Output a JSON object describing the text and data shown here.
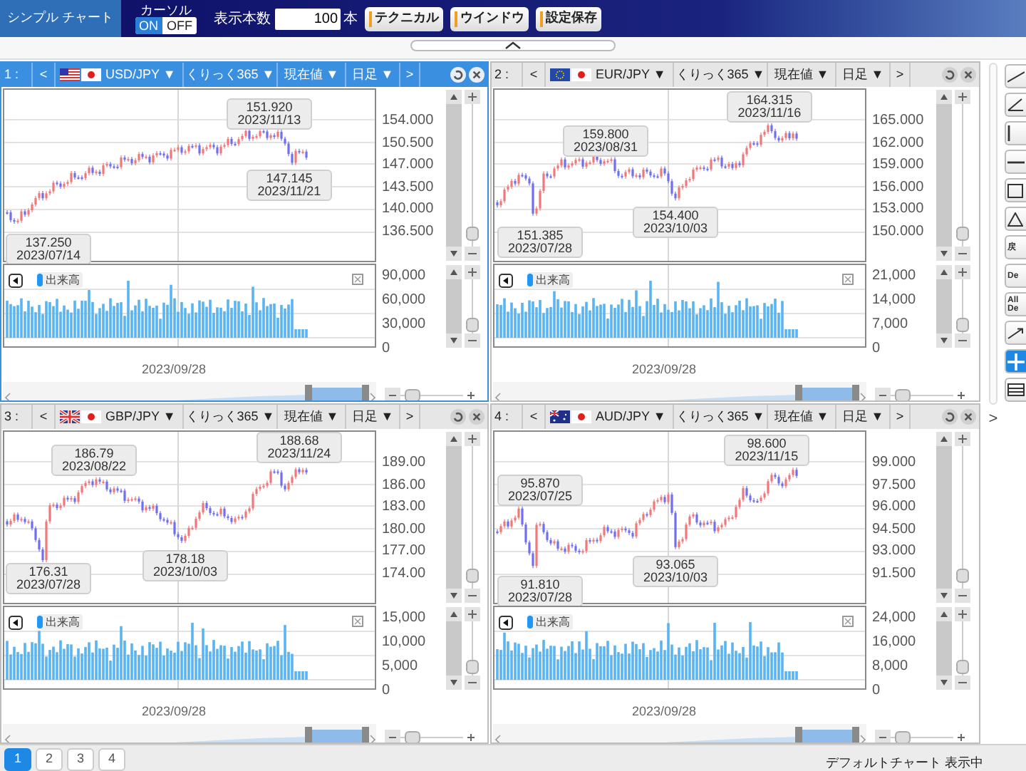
{
  "toolbar": {
    "title": "シンプル チャート",
    "cursor_label": "カーソル",
    "cursor_toggle": [
      {
        "label": "ON",
        "selected": true
      },
      {
        "label": "OFF",
        "selected": false
      }
    ],
    "count_label": "表示本数",
    "count_value": "100",
    "count_unit": "本",
    "buttons": [
      "テクニカル",
      "ウインドウ",
      "設定保存"
    ]
  },
  "panels": [
    {
      "index": "1 :",
      "active": true,
      "prev": "<",
      "pair": "USD/JPY ▼",
      "market": "くりっく365 ▼",
      "price": "現在値 ▼",
      "period": "日足 ▼",
      "next": ">",
      "y_ticks": [
        "154.000",
        "150.500",
        "147.000",
        "143.500",
        "140.000",
        "136.500"
      ],
      "annotations": [
        {
          "value": "151.920",
          "date": "2023/11/13"
        },
        {
          "value": "147.145",
          "date": "2023/11/21"
        },
        {
          "value": "137.250",
          "date": "2023/07/14"
        }
      ],
      "volume_label": "出来高",
      "volume_ticks": [
        "90,000",
        "60,000",
        "30,000",
        "0"
      ],
      "date_label": "2023/09/28",
      "price_zoom": {
        "level": 0.05
      },
      "volume_zoom": {
        "level": 0.05
      },
      "time_zoom": {
        "level": 0.1
      }
    },
    {
      "index": "2 :",
      "active": false,
      "prev": "<",
      "pair": "EUR/JPY ▼",
      "market": "くりっく365 ▼",
      "price": "現在値 ▼",
      "period": "日足 ▼",
      "next": ">",
      "y_ticks": [
        "165.000",
        "162.000",
        "159.000",
        "156.000",
        "153.000",
        "150.000"
      ],
      "annotations": [
        {
          "value": "164.315",
          "date": "2023/11/16"
        },
        {
          "value": "159.800",
          "date": "2023/08/31"
        },
        {
          "value": "154.400",
          "date": "2023/10/03"
        },
        {
          "value": "151.385",
          "date": "2023/07/28"
        }
      ],
      "volume_label": "出来高",
      "volume_ticks": [
        "21,000",
        "14,000",
        "7,000",
        "0"
      ],
      "date_label": "2023/09/28",
      "price_zoom": {
        "level": 0.05
      },
      "volume_zoom": {
        "level": 0.05
      },
      "time_zoom": {
        "level": 0.1
      }
    },
    {
      "index": "3 :",
      "active": false,
      "prev": "<",
      "pair": "GBP/JPY ▼",
      "market": "くりっく365 ▼",
      "price": "現在値 ▼",
      "period": "日足 ▼",
      "next": ">",
      "y_ticks": [
        "189.00",
        "186.00",
        "183.00",
        "180.00",
        "177.00",
        "174.00"
      ],
      "annotations": [
        {
          "value": "188.68",
          "date": "2023/11/24"
        },
        {
          "value": "186.79",
          "date": "2023/08/22"
        },
        {
          "value": "176.31",
          "date": "2023/07/28"
        },
        {
          "value": "178.18",
          "date": "2023/10/03"
        }
      ],
      "volume_label": "出来高",
      "volume_ticks": [
        "15,000",
        "10,000",
        "5,000",
        "0"
      ],
      "date_label": "2023/09/28",
      "price_zoom": {
        "level": 0.05
      },
      "volume_zoom": {
        "level": 0.05
      },
      "time_zoom": {
        "level": 0.1
      }
    },
    {
      "index": "4 :",
      "active": false,
      "prev": "<",
      "pair": "AUD/JPY ▼",
      "market": "くりっく365 ▼",
      "price": "現在値 ▼",
      "period": "日足 ▼",
      "next": ">",
      "y_ticks": [
        "99.000",
        "97.500",
        "96.000",
        "94.500",
        "93.000",
        "91.500"
      ],
      "annotations": [
        {
          "value": "98.600",
          "date": "2023/11/15"
        },
        {
          "value": "95.870",
          "date": "2023/07/25"
        },
        {
          "value": "93.065",
          "date": "2023/10/03"
        },
        {
          "value": "91.810",
          "date": "2023/07/28"
        }
      ],
      "volume_label": "出来高",
      "volume_ticks": [
        "24,000",
        "16,000",
        "8,000",
        "0"
      ],
      "date_label": "2023/09/28",
      "price_zoom": {
        "level": 0.05
      },
      "volume_zoom": {
        "level": 0.05
      },
      "time_zoom": {
        "level": 0.1
      }
    }
  ],
  "tools": [
    {
      "kind": "diagonal",
      "selected": false
    },
    {
      "kind": "angle",
      "selected": false
    },
    {
      "kind": "vertical",
      "selected": false
    },
    {
      "kind": "horizontal",
      "selected": false
    },
    {
      "kind": "rectangle",
      "selected": false
    },
    {
      "kind": "triangle",
      "selected": false
    },
    {
      "kind": "text",
      "label": "戻",
      "selected": false
    },
    {
      "kind": "text",
      "label": "De",
      "selected": false
    },
    {
      "kind": "text",
      "label": "All De",
      "selected": false
    },
    {
      "kind": "arrow",
      "selected": false
    },
    {
      "kind": "crosshair",
      "selected": true
    },
    {
      "kind": "panel",
      "selected": false
    }
  ],
  "expand": ">",
  "pages": [
    {
      "label": "1",
      "selected": true
    },
    {
      "label": "2",
      "selected": false
    },
    {
      "label": "3",
      "selected": false
    },
    {
      "label": "4",
      "selected": false
    }
  ],
  "status": "デフォルトチャート 表示中"
}
